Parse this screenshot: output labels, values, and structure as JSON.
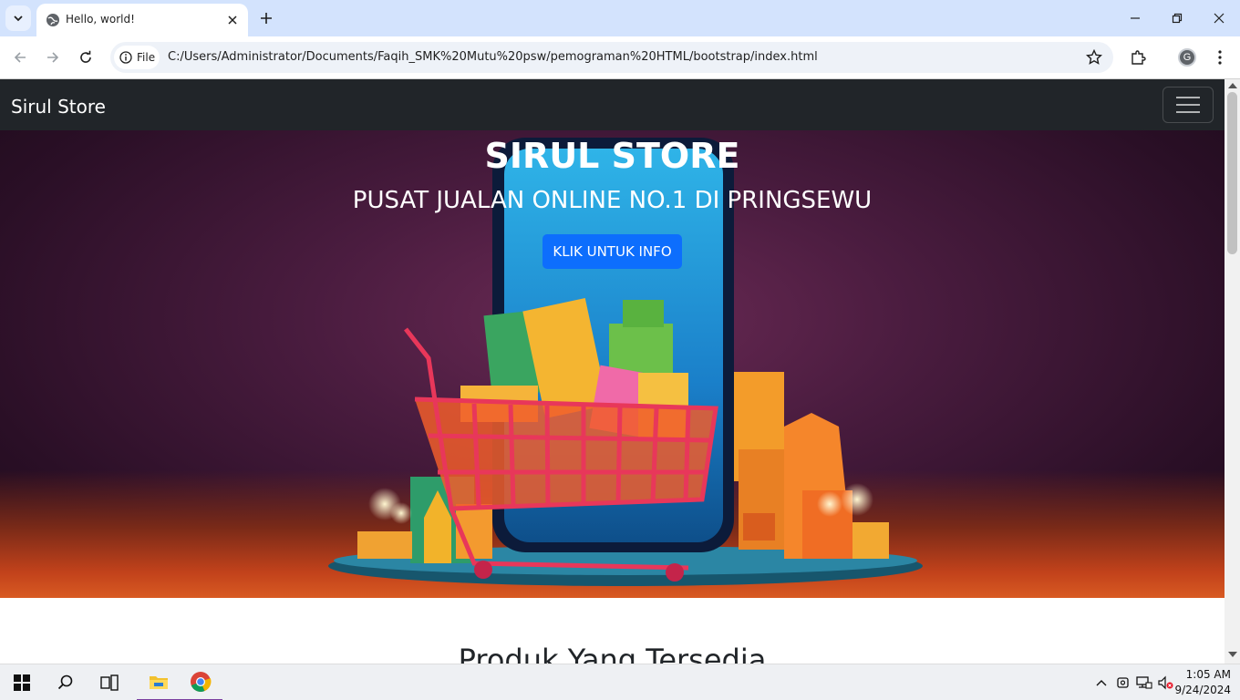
{
  "browser": {
    "tab_title": "Hello, world!",
    "site_chip_label": "File",
    "url": "C:/Users/Administrator/Documents/Faqih_SMK%20Mutu%20psw/pemograman%20HTML/bootstrap/index.html",
    "profile_initial": "G"
  },
  "page": {
    "brand": "Sirul Store",
    "hero_title": "SIRUL STORE",
    "hero_subtitle": "PUSAT JUALAN ONLINE NO.1 DI PRINGSEWU",
    "hero_button": "KLIK UNTUK INFO",
    "section_title": "Produk Yang Tersedia"
  },
  "taskbar": {
    "time": "1:05 AM",
    "date": "9/24/2024"
  },
  "colors": {
    "navbar": "#212529",
    "primary_button": "#0d6efd",
    "tabbar": "#d3e3fd"
  }
}
